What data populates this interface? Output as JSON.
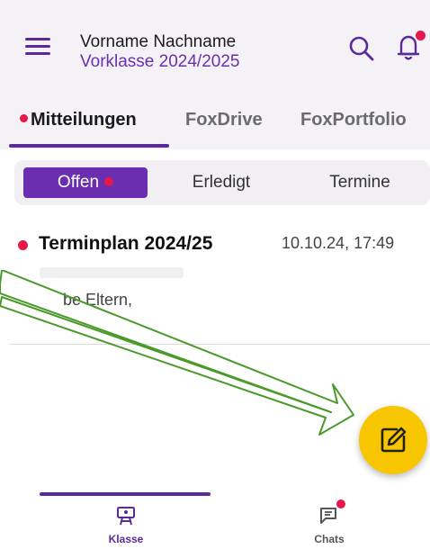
{
  "header": {
    "user_name": "Vorname Nachname",
    "class_name": "Vorklasse 2024/2025",
    "icons": [
      "menu-icon",
      "search-icon",
      "bell-icon"
    ],
    "notification_dot": true
  },
  "tabs": [
    {
      "label": "Mitteilungen",
      "active": true,
      "unread": true
    },
    {
      "label": "FoxDrive",
      "active": false
    },
    {
      "label": "FoxPortfolio",
      "active": false
    }
  ],
  "filter": {
    "items": [
      {
        "label": "Offen",
        "active": true,
        "unread": true
      },
      {
        "label": "Erledigt",
        "active": false
      },
      {
        "label": "Termine",
        "active": false
      }
    ]
  },
  "messages": [
    {
      "title": "Terminplan 2024/25",
      "date": "10.10.24, 17:49",
      "preview": "be Eltern,",
      "unread": true
    }
  ],
  "fab": {
    "icon": "edit-icon"
  },
  "bottom_nav": [
    {
      "label": "Klasse",
      "icon": "class-board-icon",
      "active": true
    },
    {
      "label": "Chats",
      "icon": "chat-icon",
      "active": false,
      "unread": true
    }
  ],
  "colors": {
    "primary": "#5a2a9a",
    "accent_dot": "#e8174a",
    "fab": "#f7c600",
    "annotation_arrow": "#4a9a2a"
  }
}
